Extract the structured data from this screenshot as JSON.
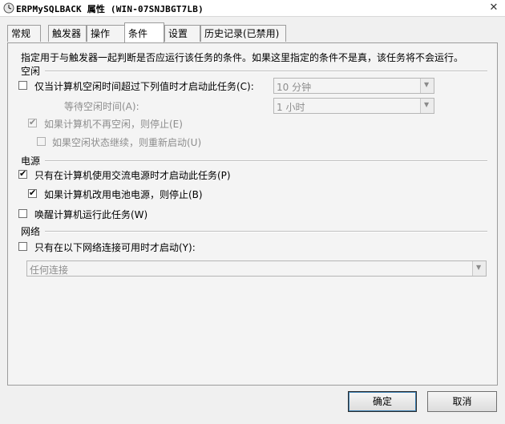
{
  "window": {
    "title": "ERPMySQLBACK 属性 (WIN-07SNJBGT7LB)",
    "close_glyph": "✕",
    "app_icon": "task-scheduler-icon"
  },
  "tabs": [
    {
      "label": "常规"
    },
    {
      "label": "触发器"
    },
    {
      "label": "操作"
    },
    {
      "label": "条件"
    },
    {
      "label": "设置"
    },
    {
      "label": "历史记录(已禁用)"
    }
  ],
  "conditions": {
    "description": "指定用于与触发器一起判断是否应运行该任务的条件。如果这里指定的条件不是真，该任务将不会运行。",
    "idle": {
      "section_label": "空闲",
      "start_if_idle_label": "仅当计算机空闲时间超过下列值时才启动此任务(C):",
      "start_if_idle_checked": false,
      "idle_duration_value": "10 分钟",
      "wait_for_idle_label": "等待空闲时间(A):",
      "wait_for_idle_value": "1 小时",
      "stop_if_not_idle_label": "如果计算机不再空闲，则停止(E)",
      "stop_if_not_idle_checked": true,
      "restart_if_idle_resumes_label": "如果空闲状态继续，则重新启动(U)",
      "restart_if_idle_resumes_checked": false
    },
    "power": {
      "section_label": "电源",
      "ac_power_only_label": "只有在计算机使用交流电源时才启动此任务(P)",
      "ac_power_only_checked": true,
      "stop_on_battery_label": "如果计算机改用电池电源，则停止(B)",
      "stop_on_battery_checked": true,
      "wake_to_run_label": "唤醒计算机运行此任务(W)",
      "wake_to_run_checked": false
    },
    "network": {
      "section_label": "网络",
      "network_only_label": "只有在以下网络连接可用时才启动(Y):",
      "network_only_checked": false,
      "connection_value": "任何连接"
    }
  },
  "buttons": {
    "ok_label": "确定",
    "cancel_label": "取消"
  },
  "check_glyph": "✔",
  "dropdown_glyph": "▼"
}
